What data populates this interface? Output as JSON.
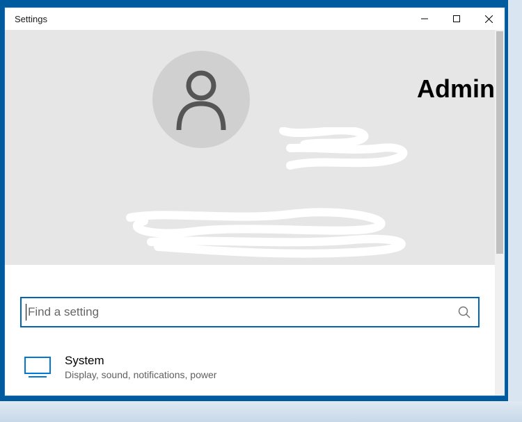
{
  "window": {
    "title": "Settings"
  },
  "hero": {
    "username": "Admin"
  },
  "search": {
    "placeholder": "Find a setting"
  },
  "categories": [
    {
      "title": "System",
      "description": "Display, sound, notifications, power"
    }
  ]
}
